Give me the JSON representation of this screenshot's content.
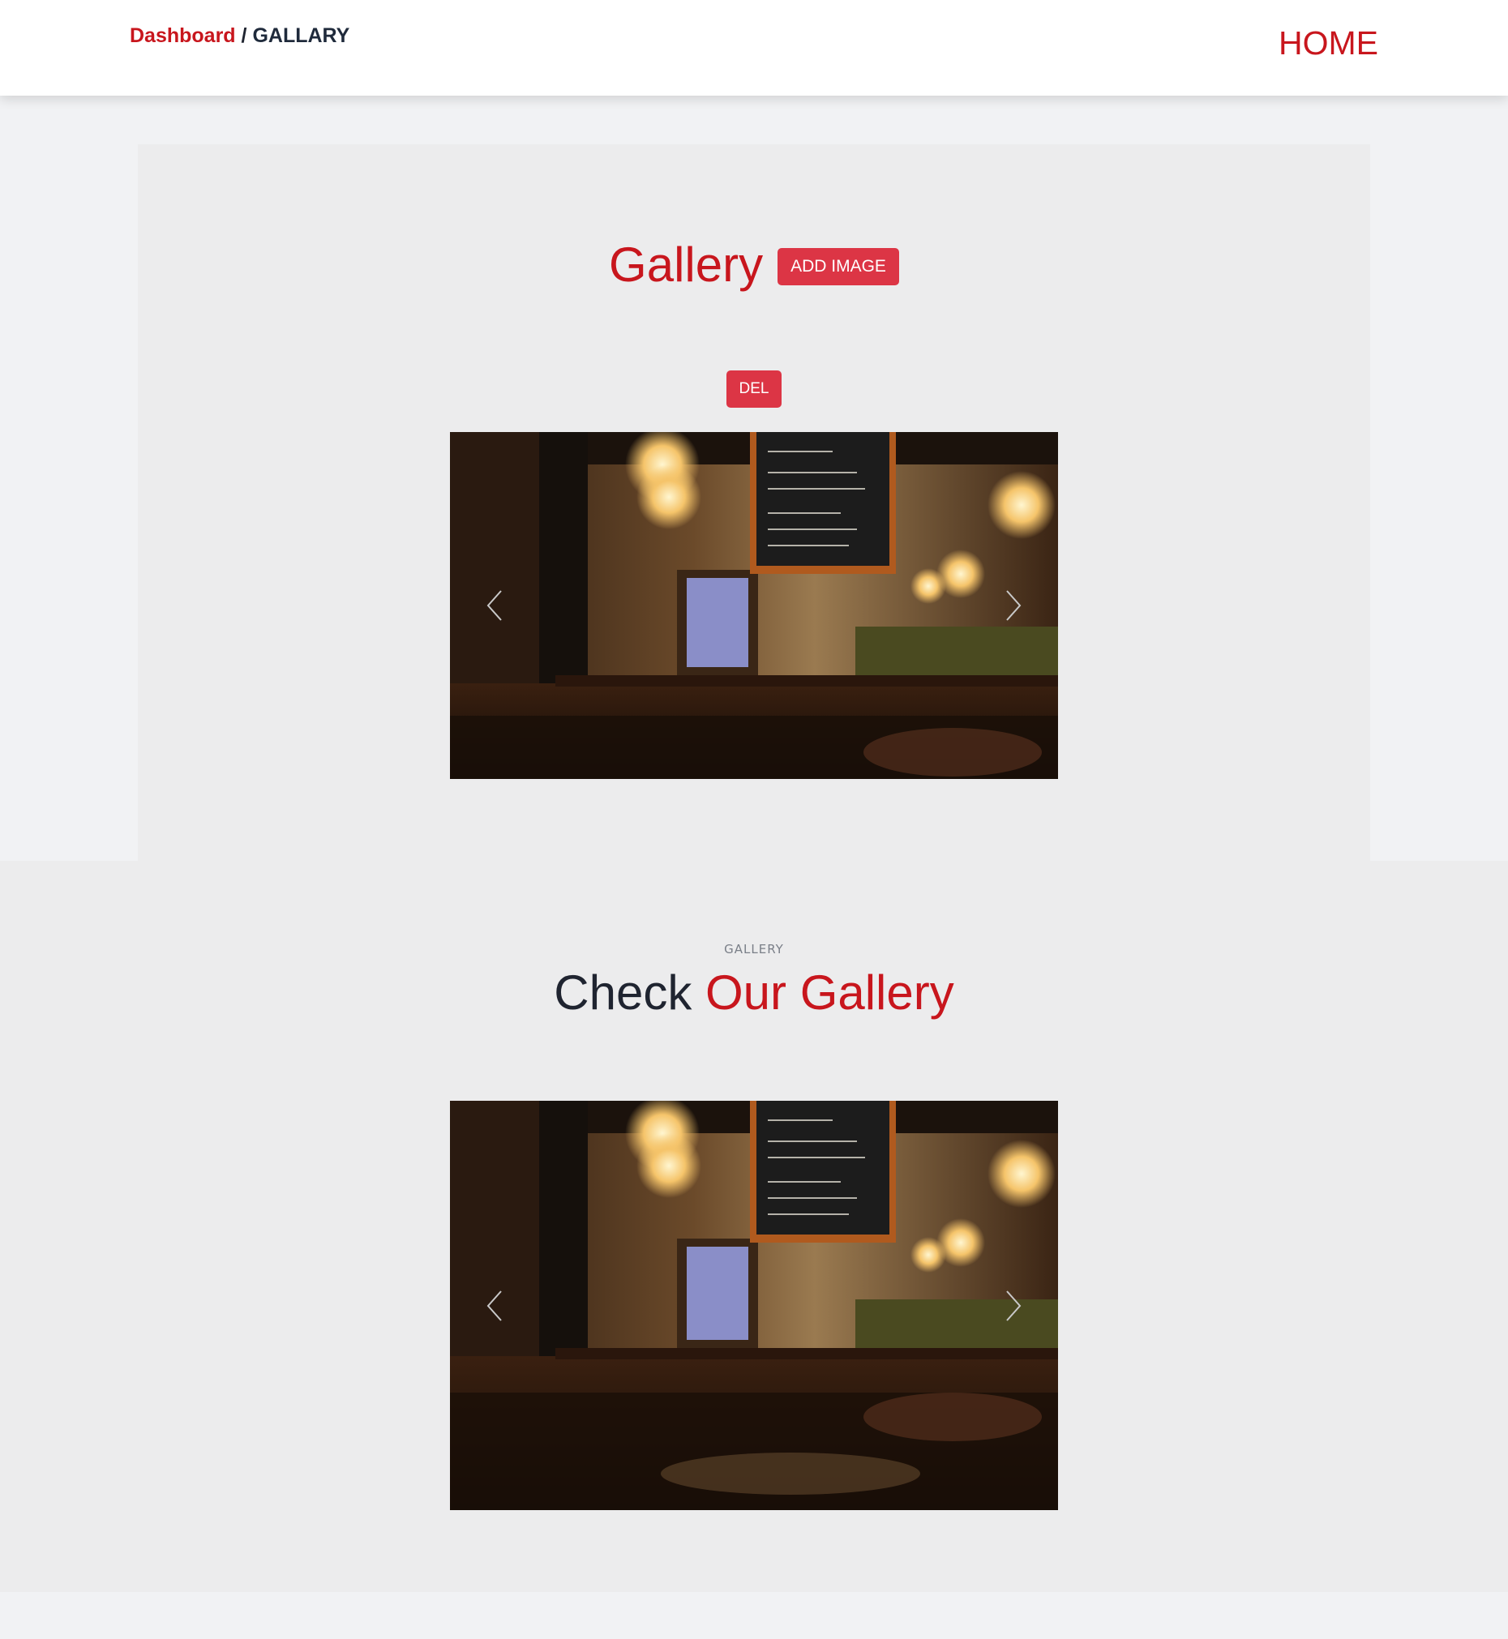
{
  "header": {
    "breadcrumb_root": "Dashboard",
    "breadcrumb_separator": "/",
    "breadcrumb_current": "GALLARY",
    "home_link": "HOME"
  },
  "admin": {
    "title": "Gallery",
    "add_button": "ADD IMAGE",
    "delete_button": "DEL"
  },
  "public_gallery": {
    "eyebrow": "GALLERY",
    "title_plain": "Check",
    "title_accent": "Our Gallery"
  },
  "carousel": {
    "prev_icon": "chevron-left-icon",
    "next_icon": "chevron-right-icon"
  },
  "colors": {
    "accent": "#c8161d",
    "button": "#dc3545",
    "panel": "#ececed",
    "page_bg": "#f1f2f4"
  }
}
